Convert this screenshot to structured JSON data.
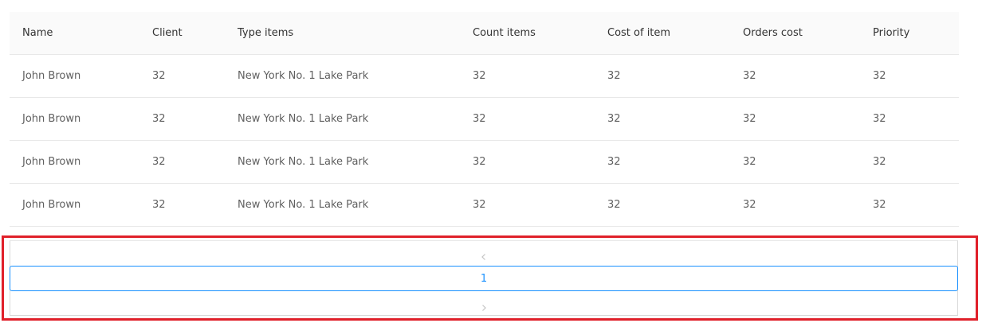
{
  "table": {
    "columns": [
      "Name",
      "Client",
      "Type items",
      "Count items",
      "Cost of item",
      "Orders cost",
      "Priority"
    ],
    "rows": [
      [
        "John Brown",
        "32",
        "New York No. 1 Lake Park",
        "32",
        "32",
        "32",
        "32"
      ],
      [
        "John Brown",
        "32",
        "New York No. 1 Lake Park",
        "32",
        "32",
        "32",
        "32"
      ],
      [
        "John Brown",
        "32",
        "New York No. 1 Lake Park",
        "32",
        "32",
        "32",
        "32"
      ],
      [
        "John Brown",
        "32",
        "New York No. 1 Lake Park",
        "32",
        "32",
        "32",
        "32"
      ]
    ]
  },
  "pagination": {
    "prev_icon": "chevron-left-icon",
    "current_page": "1",
    "next_icon": "chevron-right-icon",
    "active_color": "#1890ff"
  },
  "highlight": {
    "color": "#e0202a"
  }
}
